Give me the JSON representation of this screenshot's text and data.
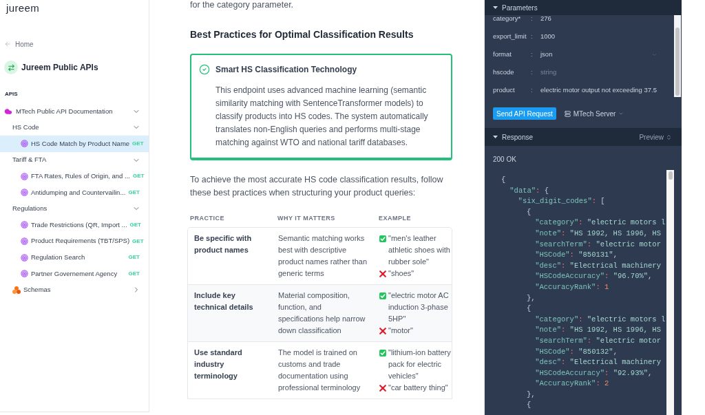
{
  "sidebar": {
    "logo": "jureem",
    "back_link": "Home",
    "project": "Jureem Public APIs",
    "section_label": "APIS",
    "tree": [
      {
        "kind": "api",
        "label": "MTech Public API Documentation",
        "expanded": true,
        "children": [
          {
            "kind": "group",
            "label": "HS Code",
            "expanded": true,
            "children": [
              {
                "kind": "endpoint",
                "label": "HS Code Match by Product Name",
                "method": "GET",
                "selected": true
              }
            ]
          },
          {
            "kind": "group",
            "label": "Tariff & FTA",
            "expanded": true,
            "children": [
              {
                "kind": "endpoint",
                "label": "FTA Rates, Rules of Origin, and ...",
                "method": "GET",
                "selected": false
              },
              {
                "kind": "endpoint",
                "label": "Antidumping and Countervailin...",
                "method": "GET",
                "selected": false
              }
            ]
          },
          {
            "kind": "group",
            "label": "Regulations",
            "expanded": true,
            "children": [
              {
                "kind": "endpoint",
                "label": "Trade Restrictions (QR, Import ...",
                "method": "GET",
                "selected": false
              },
              {
                "kind": "endpoint",
                "label": "Product Requirements (TBT/SPS)",
                "method": "GET",
                "selected": false
              },
              {
                "kind": "endpoint",
                "label": "Regulation Search",
                "method": "GET",
                "selected": false
              },
              {
                "kind": "endpoint",
                "label": "Partner Governement Agency",
                "method": "GET",
                "selected": false
              }
            ]
          }
        ]
      },
      {
        "kind": "schemas",
        "label": "Schemas",
        "expanded": false
      }
    ]
  },
  "content": {
    "intro_text": "for the category parameter.",
    "heading": "Best Practices for Optimal Classification Results",
    "callout": {
      "title": "Smart HS Classification Technology",
      "body": "This endpoint uses advanced machine learning (semantic similarity matching with SentenceTransformer models) to classify products into HS codes. The system automatically translates non-English queries and performs multi-stage matching against WTO and national tariff databases."
    },
    "paragraph": "To achieve the most accurate HS code classification results, follow these best practices when structuring your product queries:",
    "table": {
      "columns": [
        "PRACTICE",
        "WHY IT MATTERS",
        "EXAMPLE"
      ],
      "rows": [
        {
          "practice": "Be specific with product names",
          "why": "Semantic matching works best with descriptive product names rather than generic terms",
          "examples": [
            {
              "kind": "good",
              "text": "\"men's leather athletic shoes with rubber sole\""
            },
            {
              "kind": "bad",
              "text": "\"shoes\""
            }
          ]
        },
        {
          "practice": "Include key technical details",
          "why": "Material composition, function, and specifications help narrow down classification",
          "examples": [
            {
              "kind": "good",
              "text": "\"electric motor AC induction 3-phase 5HP\""
            },
            {
              "kind": "bad",
              "text": "\"motor\""
            }
          ]
        },
        {
          "practice": "Use standard industry terminology",
          "why": "The model is trained on customs and trade documentation using professional terminology",
          "examples": [
            {
              "kind": "good",
              "text": "\"lithium-ion battery pack for electric vehicles\""
            },
            {
              "kind": "bad",
              "text": "\"car battery thing\""
            }
          ]
        }
      ]
    }
  },
  "console": {
    "parameters": {
      "title": "Parameters",
      "expanded": true,
      "fields": [
        {
          "name": "category*",
          "separator": ":",
          "kind": "text",
          "value": "276"
        },
        {
          "name": "export_limit",
          "separator": ":",
          "kind": "text",
          "value": "1000"
        },
        {
          "name": "format",
          "separator": ":",
          "kind": "select",
          "value": "json"
        },
        {
          "name": "hscode",
          "separator": ":",
          "kind": "text",
          "placeholder": "string"
        },
        {
          "name": "product",
          "separator": ":",
          "kind": "text",
          "value": "electric motor output not exceeding 37.5"
        }
      ]
    },
    "send_button": "Send API Request",
    "server": "MTech Server",
    "response": {
      "title": "Response",
      "expanded": true,
      "view": "Preview",
      "status": "200 OK",
      "body": [
        {
          "tokens": [
            {
              "kind": "punct",
              "text": "{"
            }
          ],
          "children": [
            {
              "tokens": [
                {
                  "kind": "key",
                  "text": "\"data\""
                },
                {
                  "kind": "colon",
                  "text": ":"
                },
                {
                  "kind": "punct",
                  "text": " {"
                }
              ],
              "children": [
                {
                  "tokens": [
                    {
                      "kind": "key",
                      "text": "\"six_digit_codes\""
                    },
                    {
                      "kind": "colon",
                      "text": ":"
                    },
                    {
                      "kind": "punct",
                      "text": " ["
                    }
                  ],
                  "children": [
                    {
                      "tokens": [
                        {
                          "kind": "punct",
                          "text": "{"
                        }
                      ],
                      "children": [
                        {
                          "tokens": [
                            {
                              "kind": "key",
                              "text": "\"category\""
                            },
                            {
                              "kind": "colon",
                              "text": ":"
                            },
                            {
                              "kind": "string",
                              "text": " \"electric motors l"
                            }
                          ]
                        },
                        {
                          "tokens": [
                            {
                              "kind": "key",
                              "text": "\"note\""
                            },
                            {
                              "kind": "colon",
                              "text": ":"
                            },
                            {
                              "kind": "string",
                              "text": " \"HS 1992, HS 1996, HS"
                            }
                          ]
                        },
                        {
                          "tokens": [
                            {
                              "kind": "key",
                              "text": "\"searchTerm\""
                            },
                            {
                              "kind": "colon",
                              "text": ":"
                            },
                            {
                              "kind": "string",
                              "text": " \"electric motor"
                            }
                          ]
                        },
                        {
                          "tokens": [
                            {
                              "kind": "key",
                              "text": "\"HSCode\""
                            },
                            {
                              "kind": "colon",
                              "text": ":"
                            },
                            {
                              "kind": "string",
                              "text": " \"850131\""
                            },
                            {
                              "kind": "punct",
                              "text": ","
                            }
                          ]
                        },
                        {
                          "tokens": [
                            {
                              "kind": "key",
                              "text": "\"desc\""
                            },
                            {
                              "kind": "colon",
                              "text": ":"
                            },
                            {
                              "kind": "string",
                              "text": " \"Electrical machinery"
                            }
                          ]
                        },
                        {
                          "tokens": [
                            {
                              "kind": "key",
                              "text": "\"HSCodeAccuracy\""
                            },
                            {
                              "kind": "colon",
                              "text": ":"
                            },
                            {
                              "kind": "string",
                              "text": " \"96.70%\""
                            },
                            {
                              "kind": "punct",
                              "text": ","
                            }
                          ]
                        },
                        {
                          "tokens": [
                            {
                              "kind": "key",
                              "text": "\"AccuracyRank\""
                            },
                            {
                              "kind": "colon",
                              "text": ":"
                            },
                            {
                              "kind": "number",
                              "text": " 1"
                            }
                          ]
                        }
                      ]
                    },
                    {
                      "tokens": [
                        {
                          "kind": "punct",
                          "text": "},"
                        }
                      ]
                    },
                    {
                      "tokens": [
                        {
                          "kind": "punct",
                          "text": "{"
                        }
                      ],
                      "children": [
                        {
                          "tokens": [
                            {
                              "kind": "key",
                              "text": "\"category\""
                            },
                            {
                              "kind": "colon",
                              "text": ":"
                            },
                            {
                              "kind": "string",
                              "text": " \"electric motors l"
                            }
                          ]
                        },
                        {
                          "tokens": [
                            {
                              "kind": "key",
                              "text": "\"note\""
                            },
                            {
                              "kind": "colon",
                              "text": ":"
                            },
                            {
                              "kind": "string",
                              "text": " \"HS 1992, HS 1996, HS"
                            }
                          ]
                        },
                        {
                          "tokens": [
                            {
                              "kind": "key",
                              "text": "\"searchTerm\""
                            },
                            {
                              "kind": "colon",
                              "text": ":"
                            },
                            {
                              "kind": "string",
                              "text": " \"electric motor"
                            }
                          ]
                        },
                        {
                          "tokens": [
                            {
                              "kind": "key",
                              "text": "\"HSCode\""
                            },
                            {
                              "kind": "colon",
                              "text": ":"
                            },
                            {
                              "kind": "string",
                              "text": " \"850132\""
                            },
                            {
                              "kind": "punct",
                              "text": ","
                            }
                          ]
                        },
                        {
                          "tokens": [
                            {
                              "kind": "key",
                              "text": "\"desc\""
                            },
                            {
                              "kind": "colon",
                              "text": ":"
                            },
                            {
                              "kind": "string",
                              "text": " \"Electrical machinery"
                            }
                          ]
                        },
                        {
                          "tokens": [
                            {
                              "kind": "key",
                              "text": "\"HSCodeAccuracy\""
                            },
                            {
                              "kind": "colon",
                              "text": ":"
                            },
                            {
                              "kind": "string",
                              "text": " \"92.93%\""
                            },
                            {
                              "kind": "punct",
                              "text": ","
                            }
                          ]
                        },
                        {
                          "tokens": [
                            {
                              "kind": "key",
                              "text": "\"AccuracyRank\""
                            },
                            {
                              "kind": "colon",
                              "text": ":"
                            },
                            {
                              "kind": "number",
                              "text": " 2"
                            }
                          ]
                        }
                      ]
                    },
                    {
                      "tokens": [
                        {
                          "kind": "punct",
                          "text": "},"
                        }
                      ]
                    },
                    {
                      "tokens": [
                        {
                          "kind": "punct",
                          "text": "{"
                        }
                      ]
                    }
                  ]
                }
              ]
            }
          ]
        }
      ]
    }
  }
}
